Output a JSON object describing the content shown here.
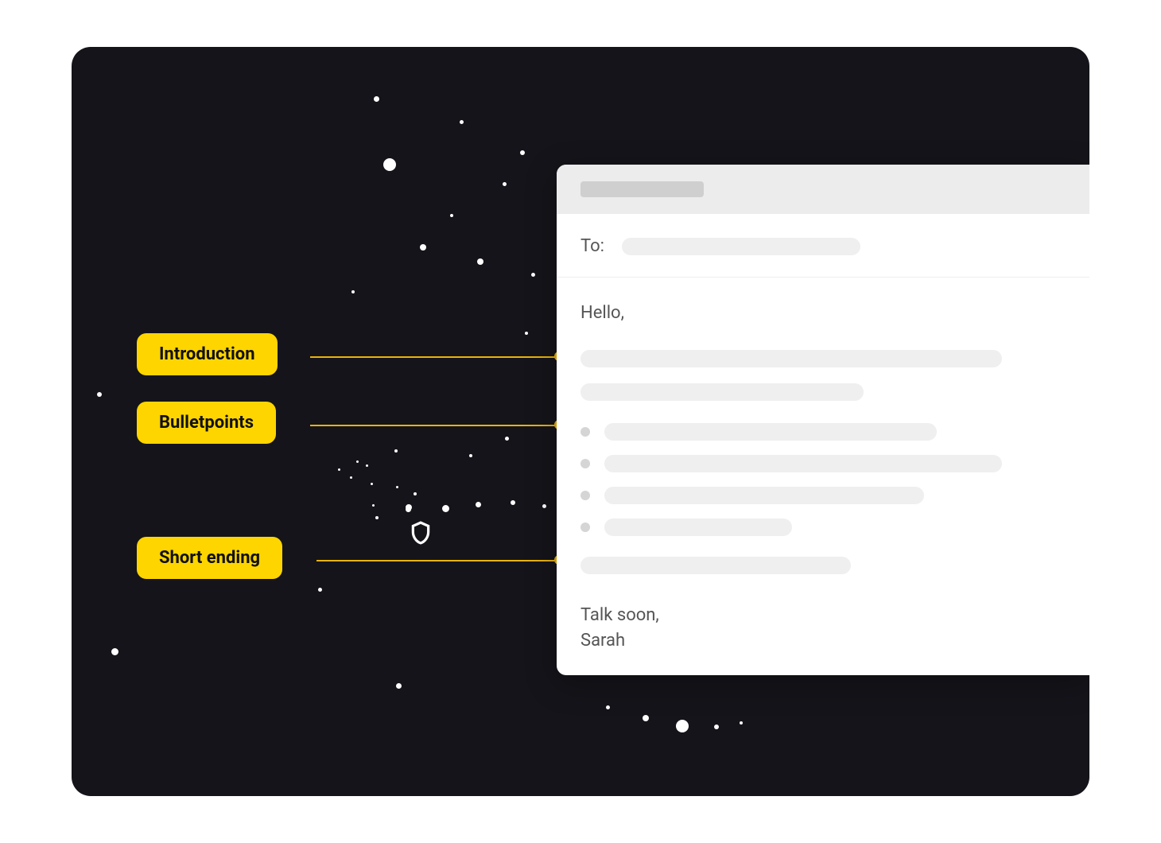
{
  "annotations": {
    "introduction": "Introduction",
    "bulletpoints": "Bulletpoints",
    "short_ending": "Short ending"
  },
  "email": {
    "to_label": "To:",
    "greeting": "Hello,",
    "signoff_line1": "Talk soon,",
    "signoff_line2": "Sarah"
  }
}
